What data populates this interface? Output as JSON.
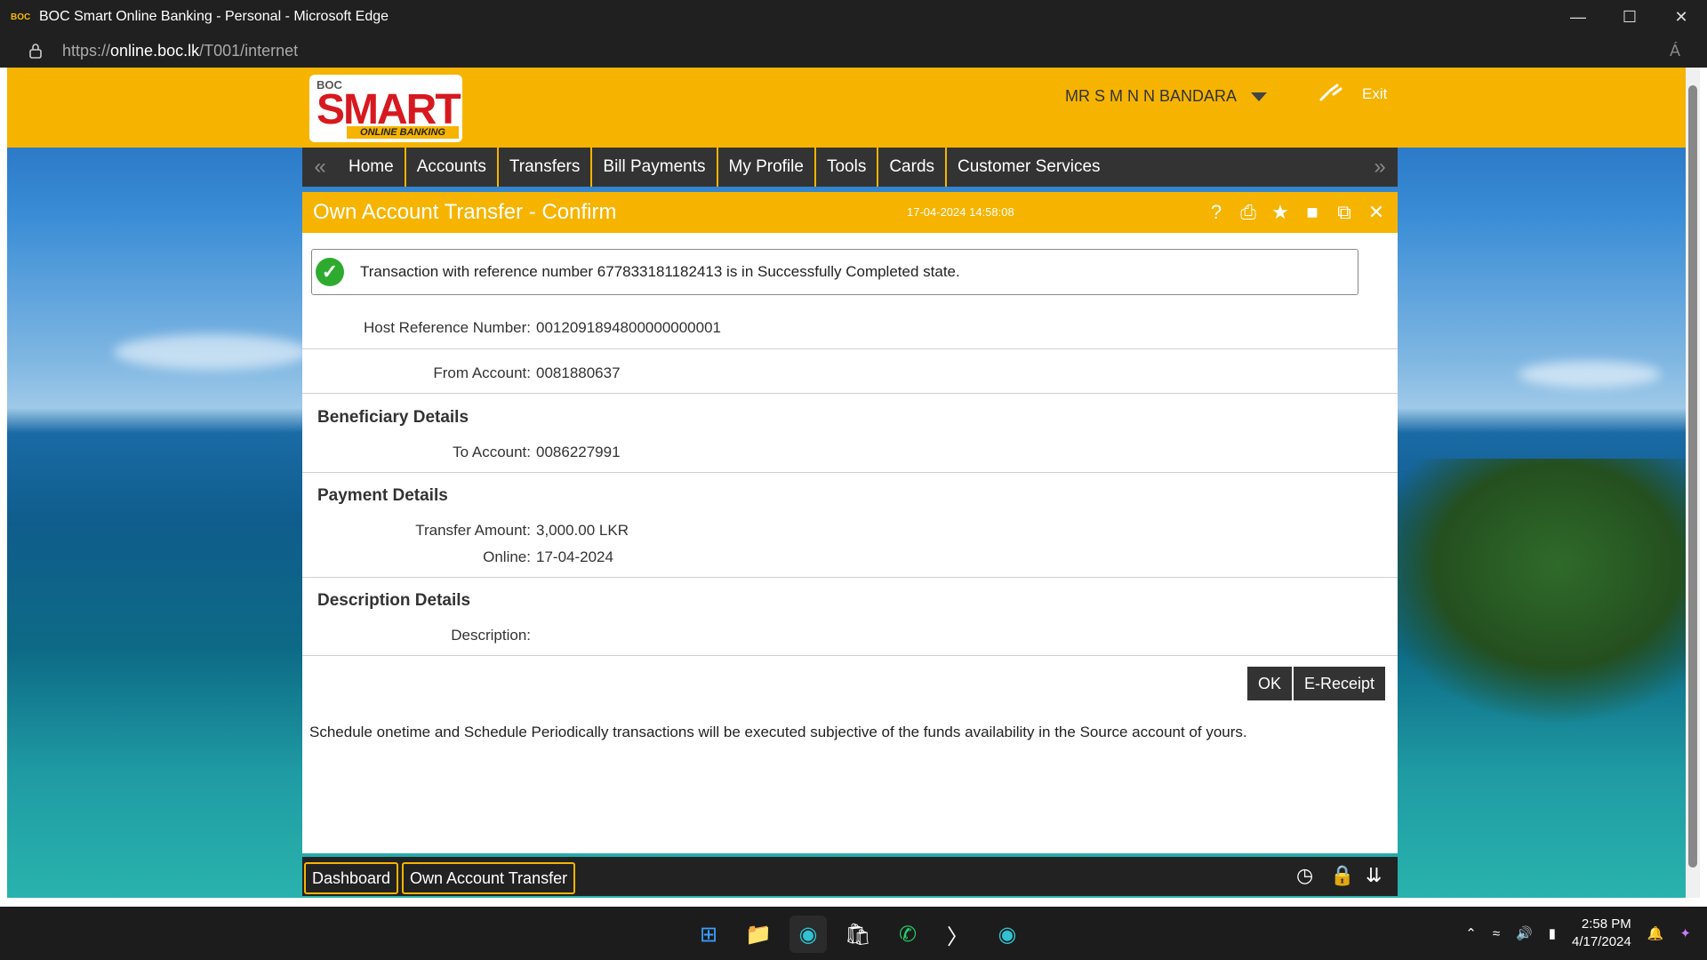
{
  "browser": {
    "window_title": "BOC Smart Online Banking - Personal - Microsoft Edge",
    "logo_text": "BOC",
    "url_prefix": "https://",
    "url_host": "online.boc.lk",
    "url_path": "/T001/internet",
    "read_aloud_icon": "Á"
  },
  "header": {
    "brand_small": "BOC",
    "brand_big": "SMART",
    "brand_tag": "ONLINE BANKING",
    "user_name": "MR S M N N BANDARA",
    "exit_label": "Exit"
  },
  "nav": {
    "items": [
      "Home",
      "Accounts",
      "Transfers",
      "Bill Payments",
      "My Profile",
      "Tools",
      "Cards",
      "Customer Services"
    ]
  },
  "panel": {
    "title": "Own Account Transfer - Confirm",
    "timestamp": "17-04-2024 14:58:08",
    "success_message": "Transaction with reference number 677833181182413 is in Successfully Completed state.",
    "host_ref_label": "Host Reference Number:",
    "host_ref_value": "0012091894800000000001",
    "from_account_label": "From Account:",
    "from_account_value": "0081880637",
    "beneficiary_heading": "Beneficiary Details",
    "to_account_label": "To Account:",
    "to_account_value": "0086227991",
    "payment_heading": "Payment Details",
    "amount_label": "Transfer Amount:",
    "amount_value": "3,000.00 LKR",
    "online_label": "Online:",
    "online_value": "17-04-2024",
    "description_heading": "Description Details",
    "description_label": "Description:",
    "description_value": "",
    "ok_label": "OK",
    "ereceipt_label": "E-Receipt",
    "note": "Schedule onetime and Schedule Periodically transactions will be executed subjective of the funds availability in the Source account of yours."
  },
  "footer": {
    "tabs": [
      "Dashboard",
      "Own Account Transfer"
    ]
  },
  "taskbar": {
    "time": "2:58 PM",
    "date": "4/17/2024"
  },
  "colors": {
    "brand_yellow": "#f6b400",
    "nav_dark": "#333333",
    "success_green": "#2eab2e",
    "brand_red": "#d7191f"
  }
}
